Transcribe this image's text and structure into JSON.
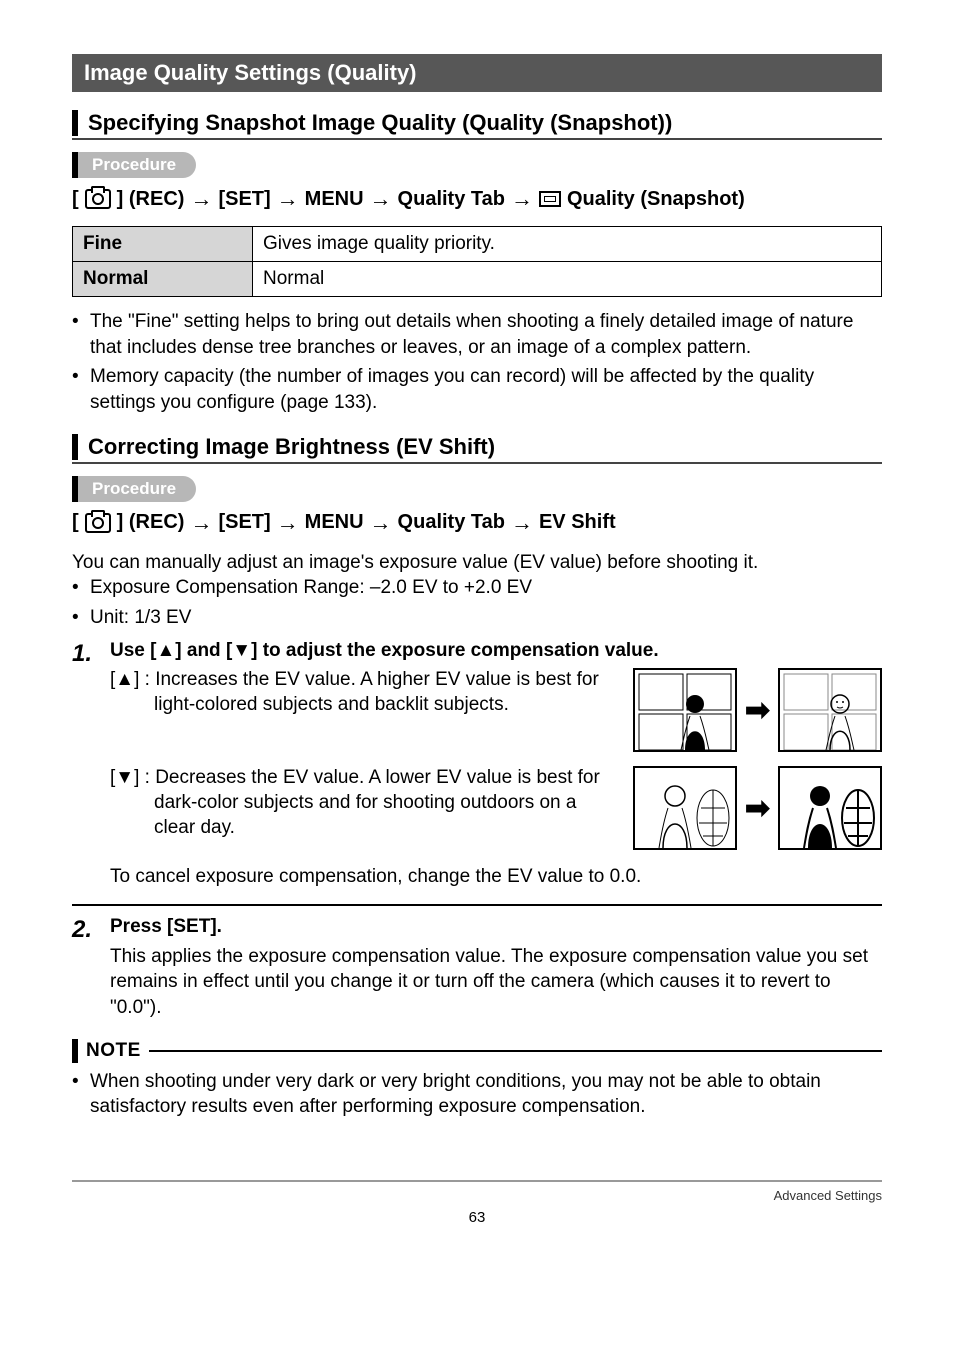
{
  "band_title": "Image Quality Settings (Quality)",
  "sec1": {
    "heading": "Specifying Snapshot Image Quality (Quality (Snapshot))",
    "proc_label": "Procedure",
    "path": {
      "p0a": "[",
      "p0b": "] (REC)",
      "p1": "[SET]",
      "p2": "MENU",
      "p3": "Quality Tab",
      "p4": "Quality (Snapshot)"
    },
    "table": {
      "r1k": "Fine",
      "r1v": "Gives image quality priority.",
      "r2k": "Normal",
      "r2v": "Normal"
    },
    "bullets": [
      "The \"Fine\" setting helps to bring out details when shooting a finely detailed image of nature that includes dense tree branches or leaves, or an image of a complex pattern.",
      "Memory capacity (the number of images you can record) will be affected by the quality settings you configure (page 133)."
    ]
  },
  "sec2": {
    "heading": "Correcting Image Brightness (EV Shift)",
    "proc_label": "Procedure",
    "path": {
      "p0a": "[",
      "p0b": "] (REC)",
      "p1": "[SET]",
      "p2": "MENU",
      "p3": "Quality Tab",
      "p4": "EV Shift"
    },
    "intro": "You can manually adjust an image's exposure value (EV value) before shooting it.",
    "bullets": [
      "Exposure Compensation Range: –2.0 EV to +2.0 EV",
      "Unit: 1/3 EV"
    ],
    "step1": {
      "num": "1.",
      "title_a": "Use [",
      "title_b": "] and [",
      "title_c": "] to adjust the exposure compensation value.",
      "up_label": "[▲] :",
      "up_text": "Increases the EV value. A higher EV value is best for light-colored subjects and backlit subjects.",
      "down_label": "[▼] :",
      "down_text": "Decreases the EV value. A lower EV value is best for dark-color subjects and for shooting outdoors on a clear day.",
      "cancel": "To cancel exposure compensation, change the EV value to 0.0."
    },
    "step2": {
      "num": "2.",
      "title": "Press [SET].",
      "body": "This applies the exposure compensation value. The exposure compensation value you set remains in effect until you change it or turn off the camera (which causes it to revert to \"0.0\")."
    }
  },
  "note": {
    "label": "NOTE",
    "text": "When shooting under very dark or very bright conditions, you may not be able to obtain satisfactory results even after performing exposure compensation."
  },
  "footer": {
    "page": "63",
    "section": "Advanced Settings"
  }
}
